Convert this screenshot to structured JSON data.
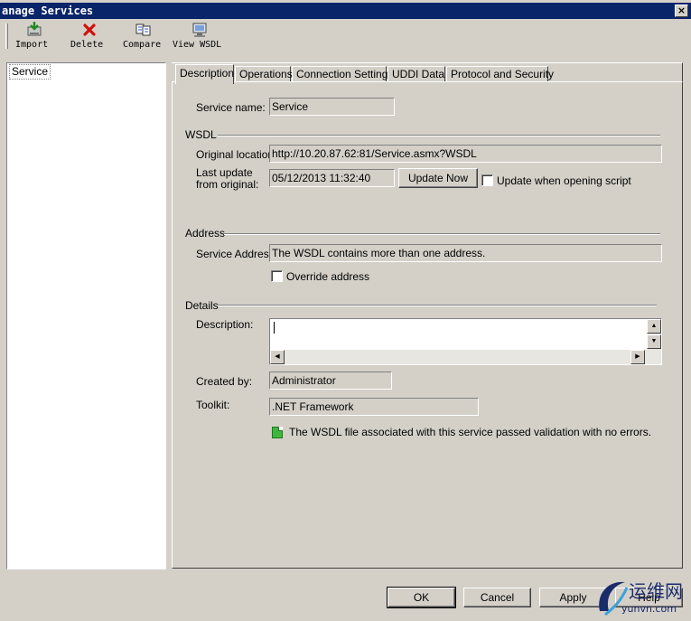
{
  "window": {
    "title": "anage Services",
    "close_glyph": "×"
  },
  "toolbar": {
    "buttons": [
      {
        "label": "Import",
        "icon": "import-icon"
      },
      {
        "label": "Delete",
        "icon": "delete-icon"
      },
      {
        "label": "Compare",
        "icon": "compare-icon"
      },
      {
        "label": "View WSDL",
        "icon": "view-wsdl-icon"
      }
    ]
  },
  "tree": {
    "items": [
      "Service"
    ]
  },
  "tabs": [
    "Description",
    "Operations",
    "Connection Settings",
    "UDDI Data",
    "Protocol and Security"
  ],
  "description": {
    "service_name_label": "Service name:",
    "service_name": "Service",
    "wsdl_group": "WSDL",
    "original_location_label": "Original location:",
    "original_location": "http://10.20.87.62:81/Service.asmx?WSDL",
    "last_update_label_1": "Last update",
    "last_update_label_2": "from original:",
    "last_update": "05/12/2013 11:32:40",
    "update_now": "Update Now",
    "update_when_opening": "Update when opening script",
    "address_group": "Address",
    "service_address_label": "Service Address:",
    "service_address": "The WSDL contains more than one address.",
    "override_address": "Override address",
    "details_group": "Details",
    "description_label": "Description:",
    "created_by_label": "Created by:",
    "created_by": "Administrator",
    "toolkit_label": "Toolkit:",
    "toolkit": ".NET Framework",
    "validation_message": "The WSDL file associated with this service passed validation with no errors."
  },
  "footer": {
    "ok": "OK",
    "cancel": "Cancel",
    "apply": "Apply",
    "help": "Help"
  },
  "watermark": {
    "text": "运维网",
    "url": "yunvn.com"
  },
  "colors": {
    "titlebar": "#0a246a",
    "face": "#d4d0c8",
    "ok_icon": "#3fb53f",
    "delete_red": "#d01010"
  }
}
